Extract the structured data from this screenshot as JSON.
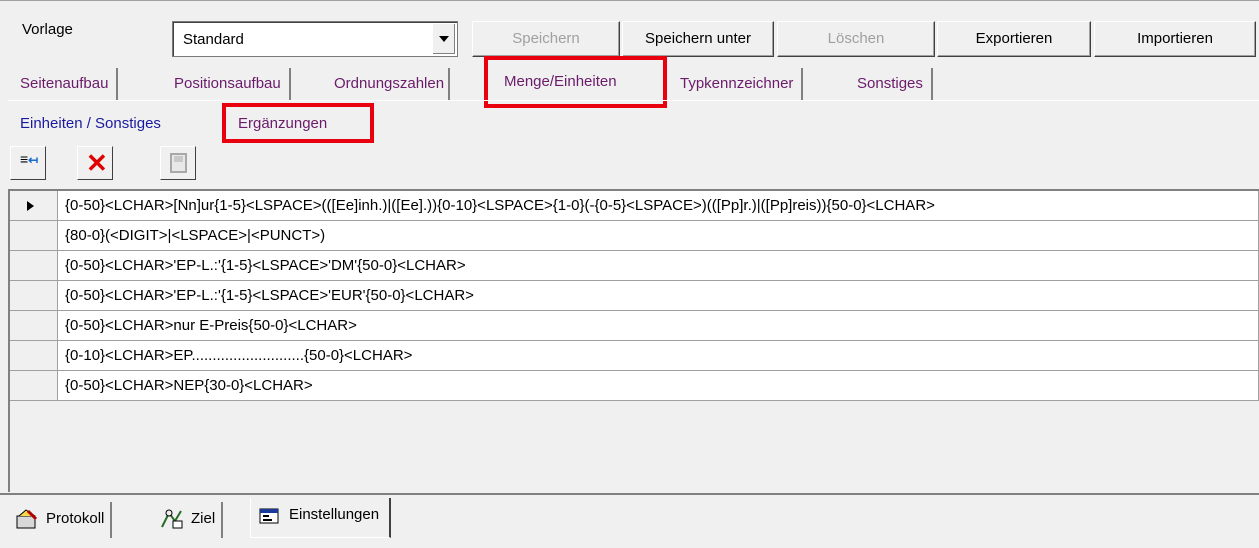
{
  "toolbar": {
    "vorlage_label": "Vorlage",
    "template_value": "Standard",
    "save_label": "Speichern",
    "save_as_label": "Speichern unter",
    "delete_label": "Löschen",
    "export_label": "Exportieren",
    "import_label": "Importieren"
  },
  "tabs_main": [
    {
      "label": "Seitenaufbau"
    },
    {
      "label": "Positionsaufbau"
    },
    {
      "label": "Ordnungszahlen"
    },
    {
      "label": "Menge/Einheiten",
      "active": true
    },
    {
      "label": "Typkennzeichner"
    },
    {
      "label": "Sonstiges"
    }
  ],
  "tabs_sub": [
    {
      "label": "Einheiten / Sonstiges"
    },
    {
      "label": "Ergänzungen",
      "active": true
    }
  ],
  "grid": {
    "rows": [
      "{0-50}<LCHAR>[Nn]ur{1-5}<LSPACE>(([Ee]inh.)|([Ee].)){0-10}<LSPACE>{1-0}(-{0-5}<LSPACE>)(([Pp]r.)|([Pp]reis)){50-0}<LCHAR>",
      "{80-0}(<DIGIT>|<LSPACE>|<PUNCT>)",
      "{0-50}<LCHAR>'EP-L.:'{1-5}<LSPACE>'DM'{50-0}<LCHAR>",
      "{0-50}<LCHAR>'EP-L.:'{1-5}<LSPACE>'EUR'{50-0}<LCHAR>",
      "{0-50}<LCHAR>nur E-Preis{50-0}<LCHAR>",
      "{0-10}<LCHAR>EP...........................{50-0}<LCHAR>",
      "{0-50}<LCHAR>NEP{30-0}<LCHAR>"
    ]
  },
  "bottom_tabs": [
    {
      "label": "Protokoll",
      "icon": "protocol-icon"
    },
    {
      "label": "Ziel",
      "icon": "target-icon"
    },
    {
      "label": "Einstellungen",
      "icon": "settings-icon",
      "active": true
    }
  ],
  "colors": {
    "highlight_red": "#e8000f",
    "main_tab_text": "#6a1b6a",
    "sub_tab_text": "#1a1aa0"
  }
}
